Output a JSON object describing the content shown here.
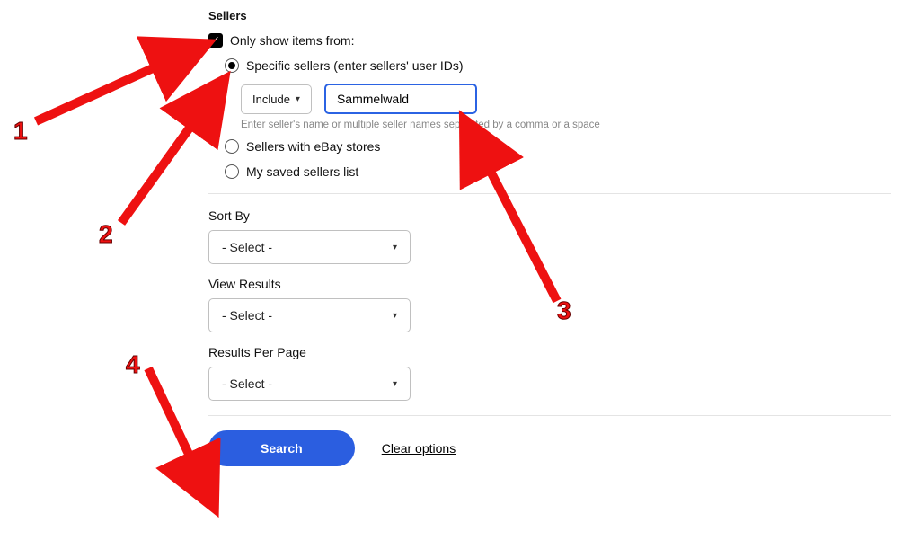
{
  "sellers": {
    "heading": "Sellers",
    "only_show_label": "Only show items from:",
    "radio_specific": "Specific sellers (enter sellers' user IDs)",
    "include_label": "Include",
    "seller_value": "Sammelwald",
    "helper": "Enter seller's name or multiple seller names separated by a comma or a space",
    "radio_stores": "Sellers with eBay stores",
    "radio_saved": "My saved sellers list"
  },
  "sort": {
    "label": "Sort By",
    "value": "- Select -"
  },
  "view": {
    "label": "View Results",
    "value": "- Select -"
  },
  "perpage": {
    "label": "Results Per Page",
    "value": "- Select -"
  },
  "actions": {
    "search": "Search",
    "clear": "Clear options"
  },
  "markers": {
    "m1": "1",
    "m2": "2",
    "m3": "3",
    "m4": "4"
  }
}
